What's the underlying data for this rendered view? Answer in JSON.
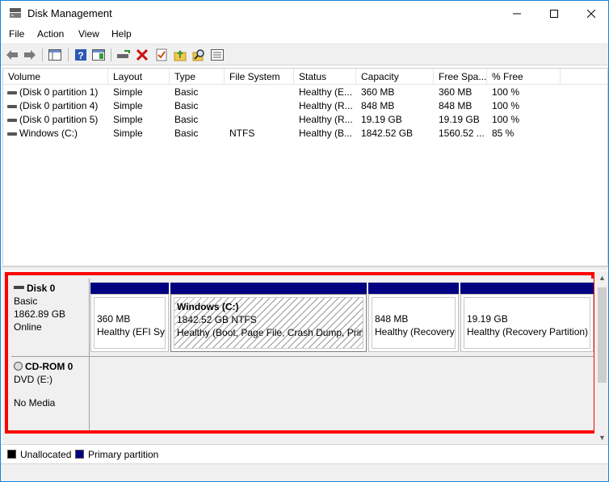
{
  "window": {
    "title": "Disk Management"
  },
  "menu": [
    "File",
    "Action",
    "View",
    "Help"
  ],
  "columns": [
    "Volume",
    "Layout",
    "Type",
    "File System",
    "Status",
    "Capacity",
    "Free Spa...",
    "% Free"
  ],
  "volumes": [
    [
      "(Disk 0 partition 1)",
      "Simple",
      "Basic",
      "",
      "Healthy (E...",
      "360 MB",
      "360 MB",
      "100 %"
    ],
    [
      "(Disk 0 partition 4)",
      "Simple",
      "Basic",
      "",
      "Healthy (R...",
      "848 MB",
      "848 MB",
      "100 %"
    ],
    [
      "(Disk 0 partition 5)",
      "Simple",
      "Basic",
      "",
      "Healthy (R...",
      "19.19 GB",
      "19.19 GB",
      "100 %"
    ],
    [
      "Windows (C:)",
      "Simple",
      "Basic",
      "NTFS",
      "Healthy (B...",
      "1842.52 GB",
      "1560.52 ...",
      "85 %"
    ]
  ],
  "disks": {
    "disk0": {
      "name": "Disk 0",
      "type": "Basic",
      "size": "1862.89 GB",
      "state": "Online",
      "partitions": [
        {
          "title": "",
          "size": "360 MB",
          "status": "Healthy (EFI Sys"
        },
        {
          "title": "Windows  (C:)",
          "size": "1842.52 GB NTFS",
          "status": "Healthy (Boot, Page File, Crash Dump, Prim"
        },
        {
          "title": "",
          "size": "848 MB",
          "status": "Healthy (Recovery"
        },
        {
          "title": "",
          "size": "19.19 GB",
          "status": "Healthy (Recovery Partition)"
        }
      ]
    },
    "cdrom0": {
      "name": "CD-ROM 0",
      "drive": "DVD (E:)",
      "media": "No Media"
    }
  },
  "legend": {
    "unallocated": "Unallocated",
    "primary": "Primary partition"
  },
  "colors": {
    "primary": "#000080",
    "unallocated": "#000000",
    "highlight": "#ff0000"
  }
}
